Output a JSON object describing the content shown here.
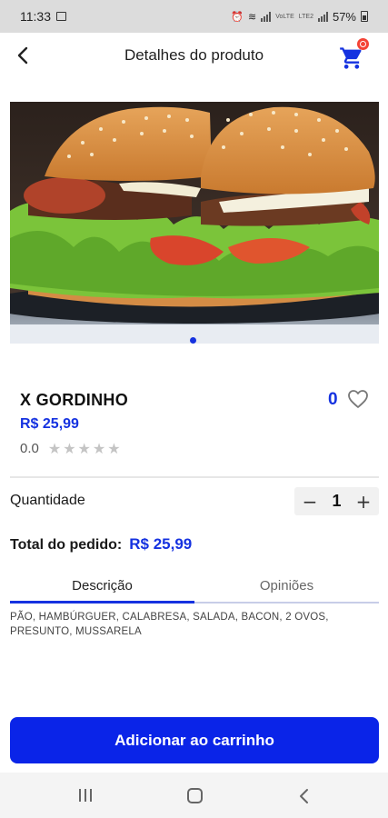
{
  "status_bar": {
    "time": "11:33",
    "battery": "57%",
    "network_label": "VoLTE",
    "network_label_2": "LTE2"
  },
  "header": {
    "title": "Detalhes do produto",
    "back_icon": "chevron-left-icon",
    "cart_icon": "shopping-cart-icon"
  },
  "product": {
    "image_icon": "burger-photo",
    "name": "X GORDINHO",
    "price": "R$ 25,99",
    "rating": "0.0",
    "stars_total": 5,
    "stars_filled": 0,
    "likes": "0",
    "heart_icon": "heart-outline-icon"
  },
  "quantity": {
    "label": "Quantidade",
    "minus": "−",
    "value": "1",
    "plus": "+"
  },
  "total": {
    "label": "Total do pedido:",
    "value": "R$ 25,99"
  },
  "tabs": [
    {
      "label": "Descrição",
      "active": true
    },
    {
      "label": "Opiniões",
      "active": false
    }
  ],
  "description": "PÃO, HAMBÚRGUER, CALABRESA, SALADA, BACON, 2 OVOS, PRESUNTO, MUSSARELA",
  "add_to_cart": {
    "label": "Adicionar ao carrinho"
  },
  "colors": {
    "accent": "#1532e0",
    "button": "#0a24e8",
    "badge": "#f44336"
  }
}
